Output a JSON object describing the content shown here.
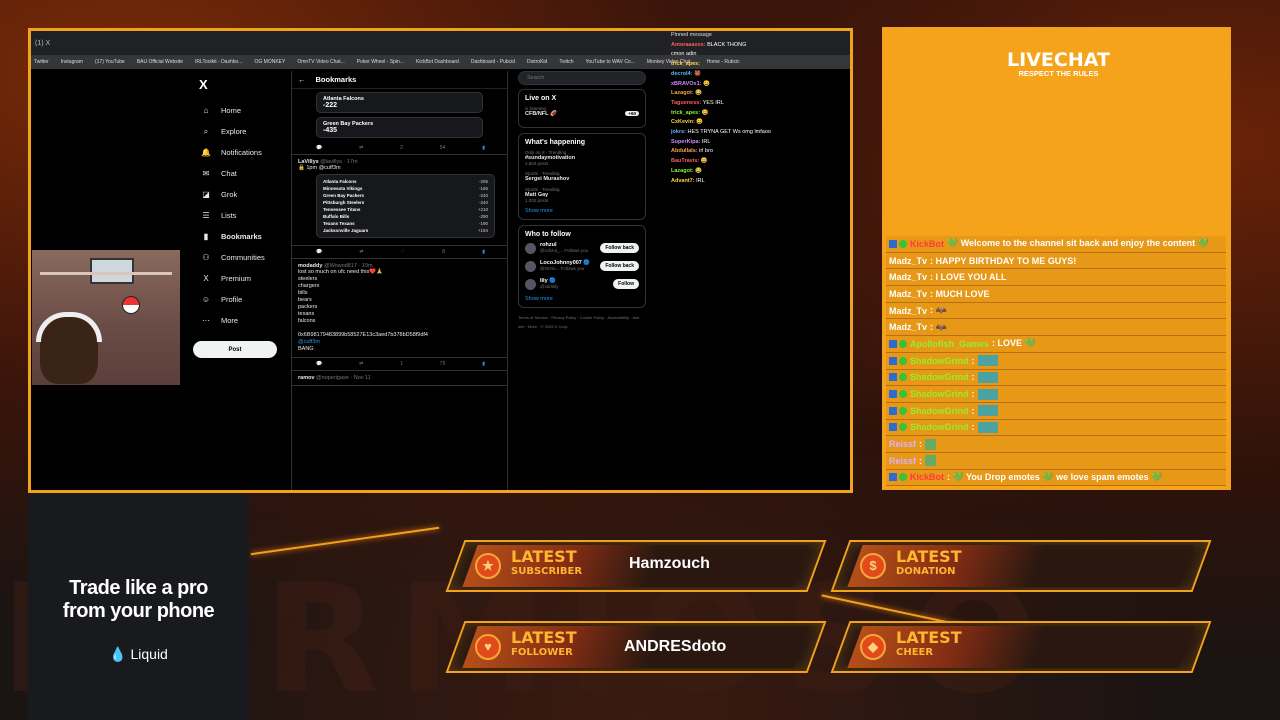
{
  "background_text": "HERMIOSO",
  "browser": {
    "url": "Bookmarks",
    "tab_title": "(1) X",
    "bookmarks_bar": [
      "Twitter",
      "Instagram",
      "(17) YouTube",
      "BAU Official Website",
      "IRLToolkit - Dashbo...",
      "OG MONKEY",
      "OmnTV Video Chat...",
      "Poker Wheel - Spin...",
      "KickBot Dashboard",
      "Dashboard - Pubcid",
      "DistroKid",
      "Twitch",
      "YouTube to WAV Co...",
      "Monkey Video Chat...",
      "Home - Rubcic"
    ]
  },
  "x_nav": {
    "logo": "X",
    "items": [
      {
        "icon": "⌂",
        "label": "Home"
      },
      {
        "icon": "⌕",
        "label": "Explore"
      },
      {
        "icon": "🔔",
        "label": "Notifications"
      },
      {
        "icon": "✉",
        "label": "Chat"
      },
      {
        "icon": "◪",
        "label": "Grok"
      },
      {
        "icon": "☰",
        "label": "Lists"
      },
      {
        "icon": "▮",
        "label": "Bookmarks"
      },
      {
        "icon": "⚇",
        "label": "Communities"
      },
      {
        "icon": "X",
        "label": "Premium"
      },
      {
        "icon": "☺",
        "label": "Profile"
      },
      {
        "icon": "⋯",
        "label": "More"
      }
    ],
    "post_label": "Post"
  },
  "feed": {
    "title": "Bookmarks",
    "card1": {
      "team_a": "Atlanta Falcons",
      "odds_a": "-222",
      "team_b": "Green Bay Packers",
      "odds_b": "-435"
    },
    "actions1": {
      "reply": "",
      "rt": "",
      "like": "2",
      "views": "54"
    },
    "tweet2": {
      "name": "LaVillys",
      "handle": "@lavillys · 17m",
      "text": "🔒 1pm @cuff3m",
      "picks": [
        {
          "team": "Atlanta Falcons",
          "odds": "-205"
        },
        {
          "team": "Minnesota Vikings",
          "odds": "-166"
        },
        {
          "team": "Green Bay Packers",
          "odds": "-240"
        },
        {
          "team": "Pittsburgh Steelers",
          "odds": "-240"
        },
        {
          "team": "Tennessee Titans",
          "odds": "+210"
        },
        {
          "team": "Buffalo Bills",
          "odds": "-290"
        },
        {
          "team": "Texans Texans",
          "odds": "-190"
        },
        {
          "team": "Jacksonville Jaguars",
          "odds": "+194"
        }
      ]
    },
    "actions2": {
      "like": "",
      "views": "8"
    },
    "tweet3": {
      "name": "modaddy",
      "handle": "@Wowod817 · 19m",
      "lines": [
        "lost so much on ufc need this❤️🙏",
        "steelers",
        "chargers",
        "bills",
        "bears",
        "packers",
        "texans",
        "falcons",
        "",
        "0x6B98179483899b58527E13c3aed7b378bD58f9df4",
        "@cuff3m",
        "BANG"
      ]
    },
    "actions3": {
      "like": "1",
      "views": "75"
    },
    "tweet4": {
      "name": "ramov",
      "handle": "@noperigase · Nov 11"
    }
  },
  "right_col": {
    "search_placeholder": "Search",
    "live_title": "Live on X",
    "live_sub": "is listening",
    "live_name": "CFB/NFL 🏈",
    "live_count": "+60",
    "happening_title": "What's happening",
    "trends": [
      {
        "cat": "Only on X · Trending",
        "title": "#sundaymotivation",
        "posts": "2,503 posts"
      },
      {
        "cat": "Sports · Trending",
        "title": "Sergei Murashov",
        "posts": ""
      },
      {
        "cat": "Sports · Trending",
        "title": "Matt Gay",
        "posts": "1,032 posts"
      }
    ],
    "show_more": "Show more",
    "follow_title": "Who to follow",
    "follows": [
      {
        "name": "rohzul",
        "handle": "@rohzul_... Follows you",
        "btn": "Follow back"
      },
      {
        "name": "LocoJohnny007 🔵",
        "handle": "@OnYo... Follows you",
        "btn": "Follow back"
      },
      {
        "name": "lily 🔵",
        "handle": "@xamlily",
        "btn": "Follow"
      }
    ],
    "footer": "Terms of Service · Privacy Policy · Cookie Policy · Accessibility · Ads info · More · © 2025 X Corp."
  },
  "browser_chat": {
    "pinned": "Pinned message",
    "messages": [
      {
        "user": "Amoraaaxxx",
        "text": "BLACK THONG"
      },
      {
        "user": "",
        "text": "cmon adin"
      },
      {
        "user": "trick_apes",
        "text": ""
      },
      {
        "user": "decrol4",
        "text": "👹"
      },
      {
        "user": "xBRAVOx1",
        "text": "😄"
      },
      {
        "user": "Lazagot",
        "text": "😂"
      },
      {
        "user": "Tagueness",
        "text": "YES IRL"
      },
      {
        "user": "trick_apes",
        "text": "😄"
      },
      {
        "user": "CxKevin",
        "text": "😄"
      },
      {
        "user": "jokrs",
        "text": "HES TRYNA GET Ws omg lmfaoo"
      },
      {
        "user": "SuperKipa",
        "text": "IRL"
      },
      {
        "user": "AbdullaIs",
        "text": "irl bro"
      },
      {
        "user": "BauTravis",
        "text": "😄"
      },
      {
        "user": "Lazagot",
        "text": "😂"
      },
      {
        "user": "Advant7",
        "text": "IRL"
      }
    ]
  },
  "livechat": {
    "title": "LIVECHAT",
    "subtitle": "RESPECT THE RULES",
    "messages": [
      {
        "user": "KickBot",
        "cls": "mod",
        "badges": true,
        "text": "💚 Welcome to the channel sit back and enjoy the content 💚"
      },
      {
        "user": "Madz_Tv",
        "cls": "white",
        "badges": false,
        "text": ": HAPPY BIRTHDAY TO ME GUYS!"
      },
      {
        "user": "Madz_Tv",
        "cls": "white",
        "badges": false,
        "text": ": I LOVE YOU ALL"
      },
      {
        "user": "Madz_Tv",
        "cls": "white",
        "badges": false,
        "text": ": MUCH LOVE"
      },
      {
        "user": "Madz_Tv",
        "cls": "white",
        "badges": false,
        "text": ": 🦇"
      },
      {
        "user": "Madz_Tv",
        "cls": "white",
        "badges": false,
        "text": ": 🦇"
      },
      {
        "user": "Apollofish_Games",
        "cls": "green",
        "badges": true,
        "text": ": LOVE 💚"
      },
      {
        "user": "ShadowGrind",
        "cls": "green",
        "badges": true,
        "text": ":"
      },
      {
        "user": "ShadowGrind",
        "cls": "green",
        "badges": true,
        "text": ":"
      },
      {
        "user": "ShadowGrind",
        "cls": "green",
        "badges": true,
        "text": ":"
      },
      {
        "user": "ShadowGrind",
        "cls": "green",
        "badges": true,
        "text": ":"
      },
      {
        "user": "ShadowGrind",
        "cls": "green",
        "badges": true,
        "text": ":"
      },
      {
        "user": "Reissf",
        "cls": "purple",
        "badges": false,
        "text": ":"
      },
      {
        "user": "Reissf",
        "cls": "purple",
        "badges": false,
        "text": ":"
      },
      {
        "user": "KickBot",
        "cls": "mod",
        "badges": true,
        "text": ": 💚 You Drop emotes 💚 we love spam emotes 💚"
      }
    ]
  },
  "alerts": {
    "subscriber": {
      "l1": "LATEST",
      "l2": "SUBSCRIBER",
      "icon": "★",
      "name": "Hamzouch"
    },
    "donation": {
      "l1": "LATEST",
      "l2": "DONATION",
      "icon": "$",
      "name": ""
    },
    "follower": {
      "l1": "LATEST",
      "l2": "FOLLOWER",
      "icon": "♥",
      "name": "ANDRESdoto"
    },
    "cheer": {
      "l1": "LATEST",
      "l2": "CHEER",
      "icon": "◆",
      "name": ""
    }
  },
  "ad": {
    "line1": "Trade like a pro",
    "line2": "from your phone",
    "brand": "💧 Liquid"
  },
  "colors": {
    "accent": "#f3a21e",
    "chat_bg": "#f5a31a",
    "x_blue": "#1d9bf0"
  }
}
